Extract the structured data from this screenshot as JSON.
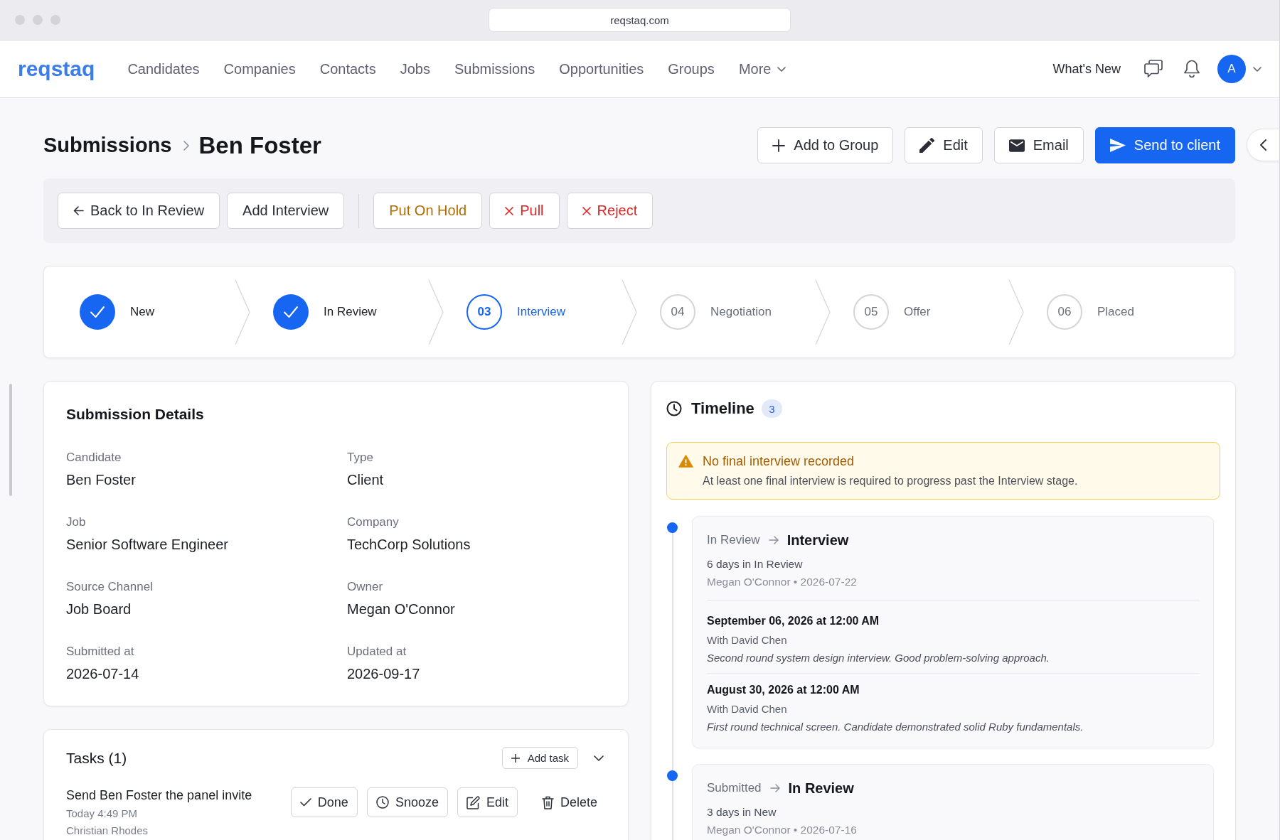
{
  "browser": {
    "url": "reqstaq.com"
  },
  "nav": {
    "logo": "reqstaq",
    "items": [
      {
        "label": "Candidates",
        "kind": "link",
        "selected": false
      },
      {
        "label": "Companies",
        "kind": "link",
        "selected": false
      },
      {
        "label": "Contacts",
        "kind": "link",
        "selected": false
      },
      {
        "label": "Jobs",
        "kind": "link",
        "selected": false
      },
      {
        "label": "Submissions",
        "kind": "link",
        "selected": false
      },
      {
        "label": "Opportunities",
        "kind": "link",
        "selected": false
      },
      {
        "label": "Groups",
        "kind": "link",
        "selected": false
      },
      {
        "label": "More",
        "kind": "dropdown",
        "selected": false
      }
    ],
    "whats_new": "What's New",
    "avatar": "A"
  },
  "header": {
    "breadcrumb": "Submissions",
    "title": "Ben Foster",
    "actions": [
      {
        "label": "Add to Group",
        "kind": "add"
      },
      {
        "label": "Edit",
        "kind": "edit"
      },
      {
        "label": "Email",
        "kind": "email"
      },
      {
        "label": "Send to client",
        "kind": "send"
      }
    ]
  },
  "action_bar": {
    "groups": [
      {
        "buttons": [
          {
            "label": "Back to In Review",
            "kind": "back"
          },
          {
            "label": "Add Interview",
            "kind": "plain"
          }
        ]
      },
      {
        "buttons": [
          {
            "label": "Put On Hold",
            "kind": "warning"
          },
          {
            "label": "Pull",
            "kind": "danger"
          },
          {
            "label": "Reject",
            "kind": "danger"
          }
        ]
      }
    ]
  },
  "stepper": {
    "steps": [
      {
        "label": "New",
        "done": true,
        "selected": false
      },
      {
        "label": "In Review",
        "done": true,
        "selected": false
      },
      {
        "number": "03",
        "label": "Interview",
        "done": false,
        "selected": true
      },
      {
        "number": "04",
        "label": "Negotiation",
        "done": false,
        "selected": false
      },
      {
        "number": "05",
        "label": "Offer",
        "done": false,
        "selected": false
      },
      {
        "number": "06",
        "label": "Placed",
        "done": false,
        "selected": false
      }
    ]
  },
  "details": {
    "title": "Submission Details",
    "fields": [
      {
        "label": "Candidate",
        "value": "Ben Foster"
      },
      {
        "label": "Type",
        "value": "Client"
      },
      {
        "label": "Job",
        "value": "Senior Software Engineer"
      },
      {
        "label": "Company",
        "value": "TechCorp Solutions"
      },
      {
        "label": "Source Channel",
        "value": "Job Board"
      },
      {
        "label": "Owner",
        "value": "Megan O'Connor"
      },
      {
        "label": "Submitted at",
        "value": "2026-07-14"
      },
      {
        "label": "Updated at",
        "value": "2026-09-17"
      }
    ]
  },
  "tasks": {
    "title": "Tasks (1)",
    "add_label": "Add task",
    "items": [
      {
        "title": "Send Ben Foster the panel invite",
        "due": "Today 4:49 PM",
        "assignee": "Christian Rhodes",
        "actions": [
          {
            "label": "Done",
            "kind": "done"
          },
          {
            "label": "Snooze",
            "kind": "snooze"
          },
          {
            "label": "Edit",
            "kind": "edit"
          },
          {
            "label": "Delete",
            "kind": "delete"
          }
        ]
      }
    ]
  },
  "timeline": {
    "title": "Timeline",
    "count": "3",
    "alert": {
      "title": "No final interview recorded",
      "text": "At least one final interview is required to progress past the Interview stage."
    },
    "entries": [
      {
        "from": "In Review",
        "to": "Interview",
        "duration": "6 days in In Review",
        "meta": "Megan O'Connor • 2026-07-22",
        "interviews": [
          {
            "when": "September 06, 2026 at 12:00 AM",
            "with": "With David Chen",
            "note": "Second round system design interview. Good problem-solving approach."
          },
          {
            "when": "August 30, 2026 at 12:00 AM",
            "with": "With David Chen",
            "note": "First round technical screen. Candidate demonstrated solid Ruby fundamentals."
          }
        ]
      },
      {
        "from": "Submitted",
        "to": "In Review",
        "duration": "3 days in New",
        "meta": "Megan O'Connor • 2026-07-16"
      }
    ]
  }
}
